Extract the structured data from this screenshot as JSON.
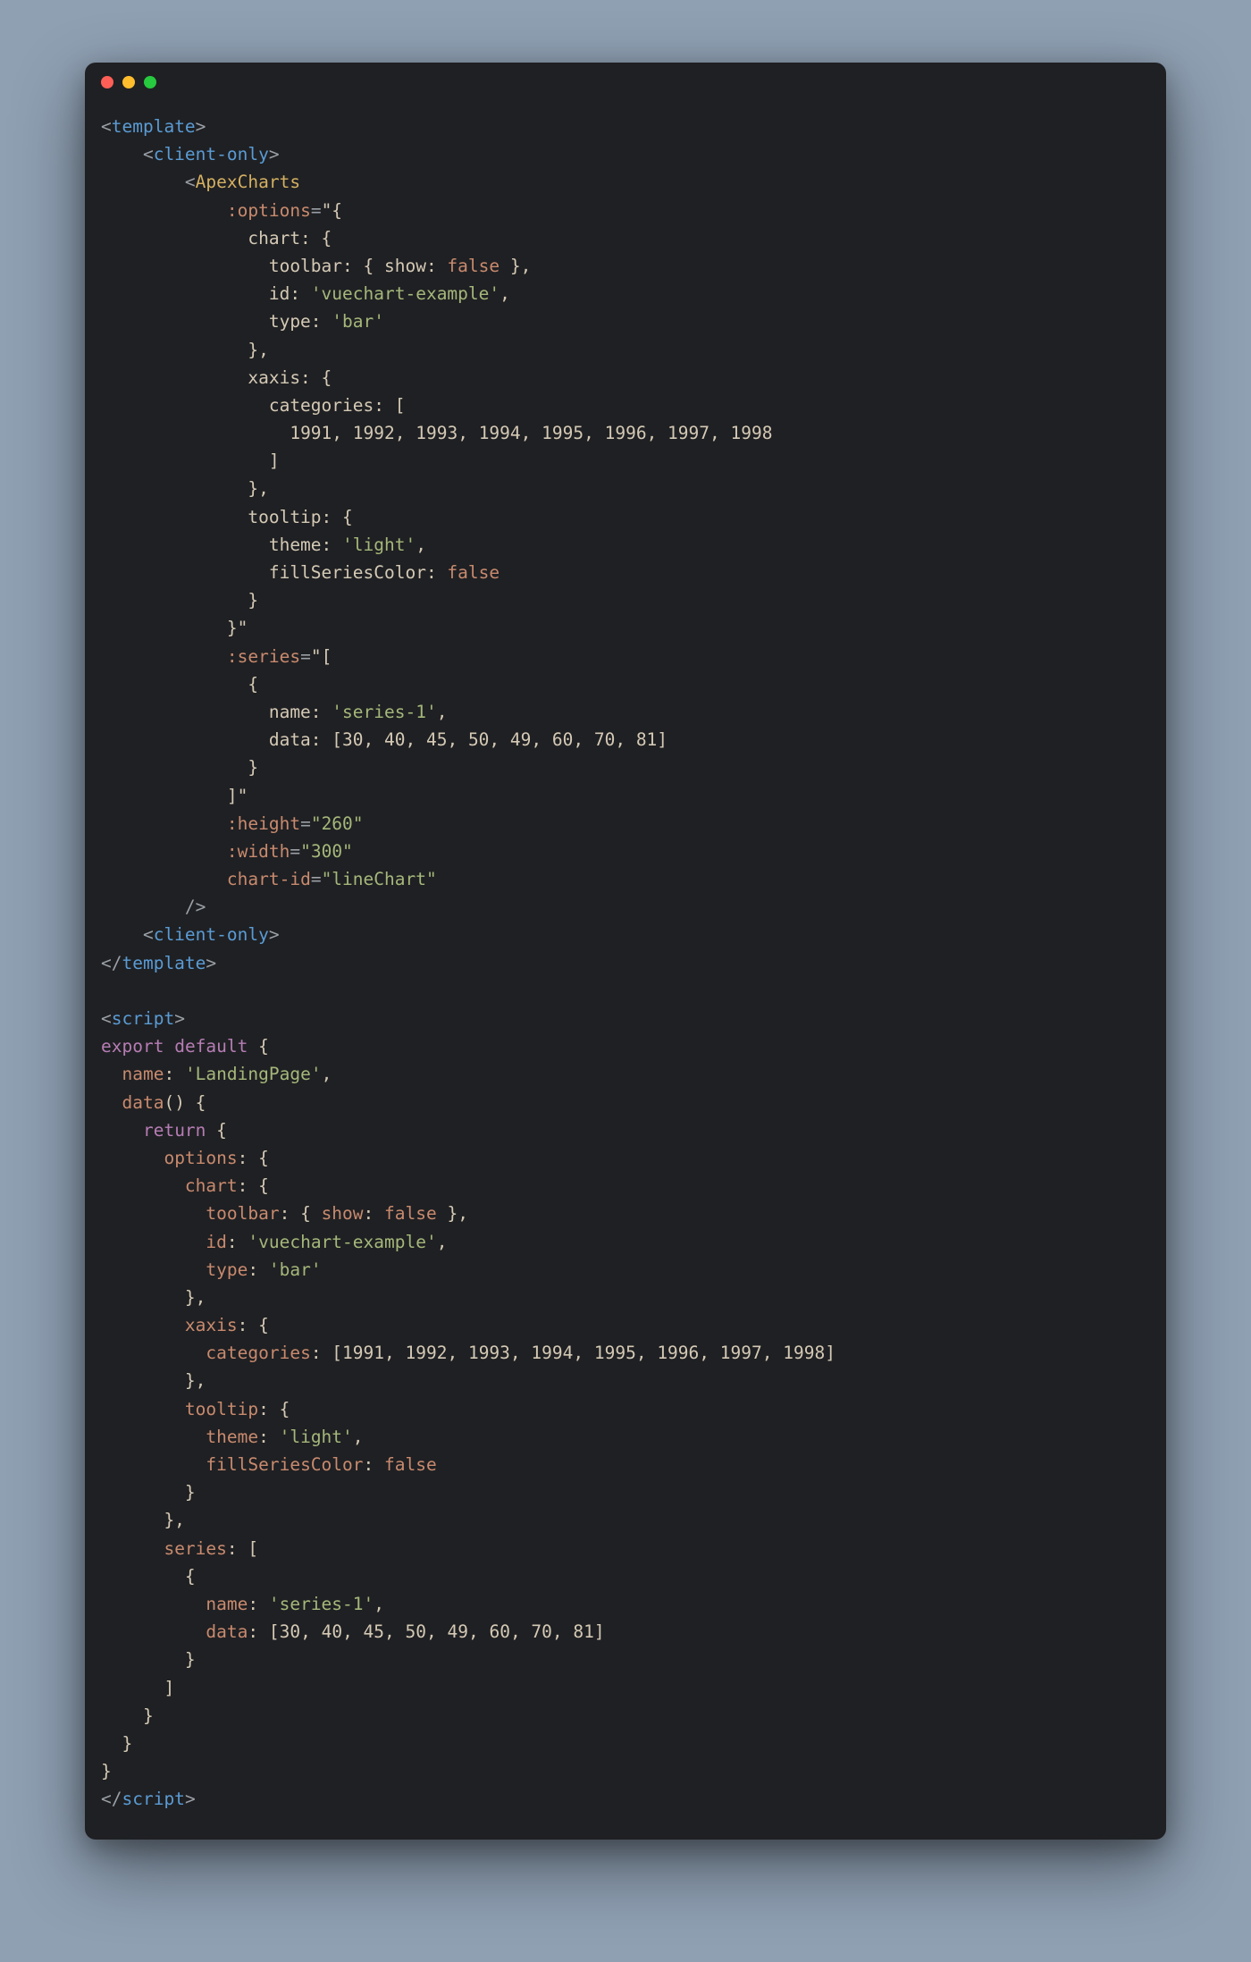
{
  "titlebar": {
    "red": "",
    "yellow": "",
    "green": ""
  },
  "code": {
    "l01_a": "<",
    "l01_b": "template",
    "l01_c": ">",
    "l02_a": "    <",
    "l02_b": "client-only",
    "l02_c": ">",
    "l03_a": "        <",
    "l03_b": "ApexCharts",
    "l04_a": "            ",
    "l04_b": ":options",
    "l04_c": "=",
    "l04_d": "\"{",
    "l05_a": "              chart: {",
    "l06_a": "                toolbar: { show: ",
    "l06_b": "false",
    "l06_c": " },",
    "l07_a": "                id: ",
    "l07_b": "'vuechart-example'",
    "l07_c": ",",
    "l08_a": "                type: ",
    "l08_b": "'bar'",
    "l09_a": "              },",
    "l10_a": "              xaxis: {",
    "l11_a": "                categories: [",
    "l12_a": "                  ",
    "l12_b": "1991",
    "l12_c": ", ",
    "l12_d": "1992",
    "l12_e": ", ",
    "l12_f": "1993",
    "l12_g": ", ",
    "l12_h": "1994",
    "l12_i": ", ",
    "l12_j": "1995",
    "l12_k": ", ",
    "l12_l": "1996",
    "l12_m": ", ",
    "l12_n": "1997",
    "l12_o": ", ",
    "l12_p": "1998",
    "l13_a": "                ]",
    "l14_a": "              },",
    "l15_a": "              tooltip: {",
    "l16_a": "                theme: ",
    "l16_b": "'light'",
    "l16_c": ",",
    "l17_a": "                fillSeriesColor: ",
    "l17_b": "false",
    "l18_a": "              }",
    "l19_a": "            }\"",
    "l20_a": "            ",
    "l20_b": ":series",
    "l20_c": "=",
    "l20_d": "\"[",
    "l21_a": "              {",
    "l22_a": "                name: ",
    "l22_b": "'series-1'",
    "l22_c": ",",
    "l23_a": "                data: [",
    "l23_b": "30",
    "l23_c": ", ",
    "l23_d": "40",
    "l23_e": ", ",
    "l23_f": "45",
    "l23_g": ", ",
    "l23_h": "50",
    "l23_i": ", ",
    "l23_j": "49",
    "l23_k": ", ",
    "l23_l": "60",
    "l23_m": ", ",
    "l23_n": "70",
    "l23_o": ", ",
    "l23_p": "81",
    "l23_q": "]",
    "l24_a": "              }",
    "l25_a": "            ]\"",
    "l26_a": "            ",
    "l26_b": ":height",
    "l26_c": "=",
    "l26_d": "\"260\"",
    "l27_a": "            ",
    "l27_b": ":width",
    "l27_c": "=",
    "l27_d": "\"300\"",
    "l28_a": "            ",
    "l28_b": "chart-id",
    "l28_c": "=",
    "l28_d": "\"lineChart\"",
    "l29_a": "        />",
    "l30_a": "    <",
    "l30_b": "client-only",
    "l30_c": ">",
    "l31_a": "</",
    "l31_b": "template",
    "l31_c": ">",
    "l32_a": "",
    "l33_a": "<",
    "l33_b": "script",
    "l33_c": ">",
    "l34_a": "export",
    "l34_b": " ",
    "l34_c": "default",
    "l34_d": " {",
    "l35_a": "  ",
    "l35_b": "name",
    "l35_c": ": ",
    "l35_d": "'LandingPage'",
    "l35_e": ",",
    "l36_a": "  ",
    "l36_b": "data",
    "l36_c": "() {",
    "l37_a": "    ",
    "l37_b": "return",
    "l37_c": " {",
    "l38_a": "      ",
    "l38_b": "options",
    "l38_c": ": {",
    "l39_a": "        ",
    "l39_b": "chart",
    "l39_c": ": {",
    "l40_a": "          ",
    "l40_b": "toolbar",
    "l40_c": ": { ",
    "l40_d": "show",
    "l40_e": ": ",
    "l40_f": "false",
    "l40_g": " },",
    "l41_a": "          ",
    "l41_b": "id",
    "l41_c": ": ",
    "l41_d": "'vuechart-example'",
    "l41_e": ",",
    "l42_a": "          ",
    "l42_b": "type",
    "l42_c": ": ",
    "l42_d": "'bar'",
    "l43_a": "        },",
    "l44_a": "        ",
    "l44_b": "xaxis",
    "l44_c": ": {",
    "l45_a": "          ",
    "l45_b": "categories",
    "l45_c": ": [",
    "l45_d": "1991",
    "l45_e": ", ",
    "l45_f": "1992",
    "l45_g": ", ",
    "l45_h": "1993",
    "l45_i": ", ",
    "l45_j": "1994",
    "l45_k": ", ",
    "l45_l": "1995",
    "l45_m": ", ",
    "l45_n": "1996",
    "l45_o": ", ",
    "l45_p": "1997",
    "l45_q": ", ",
    "l45_r": "1998",
    "l45_s": "]",
    "l46_a": "        },",
    "l47_a": "        ",
    "l47_b": "tooltip",
    "l47_c": ": {",
    "l48_a": "          ",
    "l48_b": "theme",
    "l48_c": ": ",
    "l48_d": "'light'",
    "l48_e": ",",
    "l49_a": "          ",
    "l49_b": "fillSeriesColor",
    "l49_c": ": ",
    "l49_d": "false",
    "l50_a": "        }",
    "l51_a": "      },",
    "l52_a": "      ",
    "l52_b": "series",
    "l52_c": ": [",
    "l53_a": "        {",
    "l54_a": "          ",
    "l54_b": "name",
    "l54_c": ": ",
    "l54_d": "'series-1'",
    "l54_e": ",",
    "l55_a": "          ",
    "l55_b": "data",
    "l55_c": ": [",
    "l55_d": "30",
    "l55_e": ", ",
    "l55_f": "40",
    "l55_g": ", ",
    "l55_h": "45",
    "l55_i": ", ",
    "l55_j": "50",
    "l55_k": ", ",
    "l55_l": "49",
    "l55_m": ", ",
    "l55_n": "60",
    "l55_o": ", ",
    "l55_p": "70",
    "l55_q": ", ",
    "l55_r": "81",
    "l55_s": "]",
    "l56_a": "        }",
    "l57_a": "      ]",
    "l58_a": "    }",
    "l59_a": "  }",
    "l60_a": "}",
    "l61_a": "</",
    "l61_b": "script",
    "l61_c": ">"
  }
}
